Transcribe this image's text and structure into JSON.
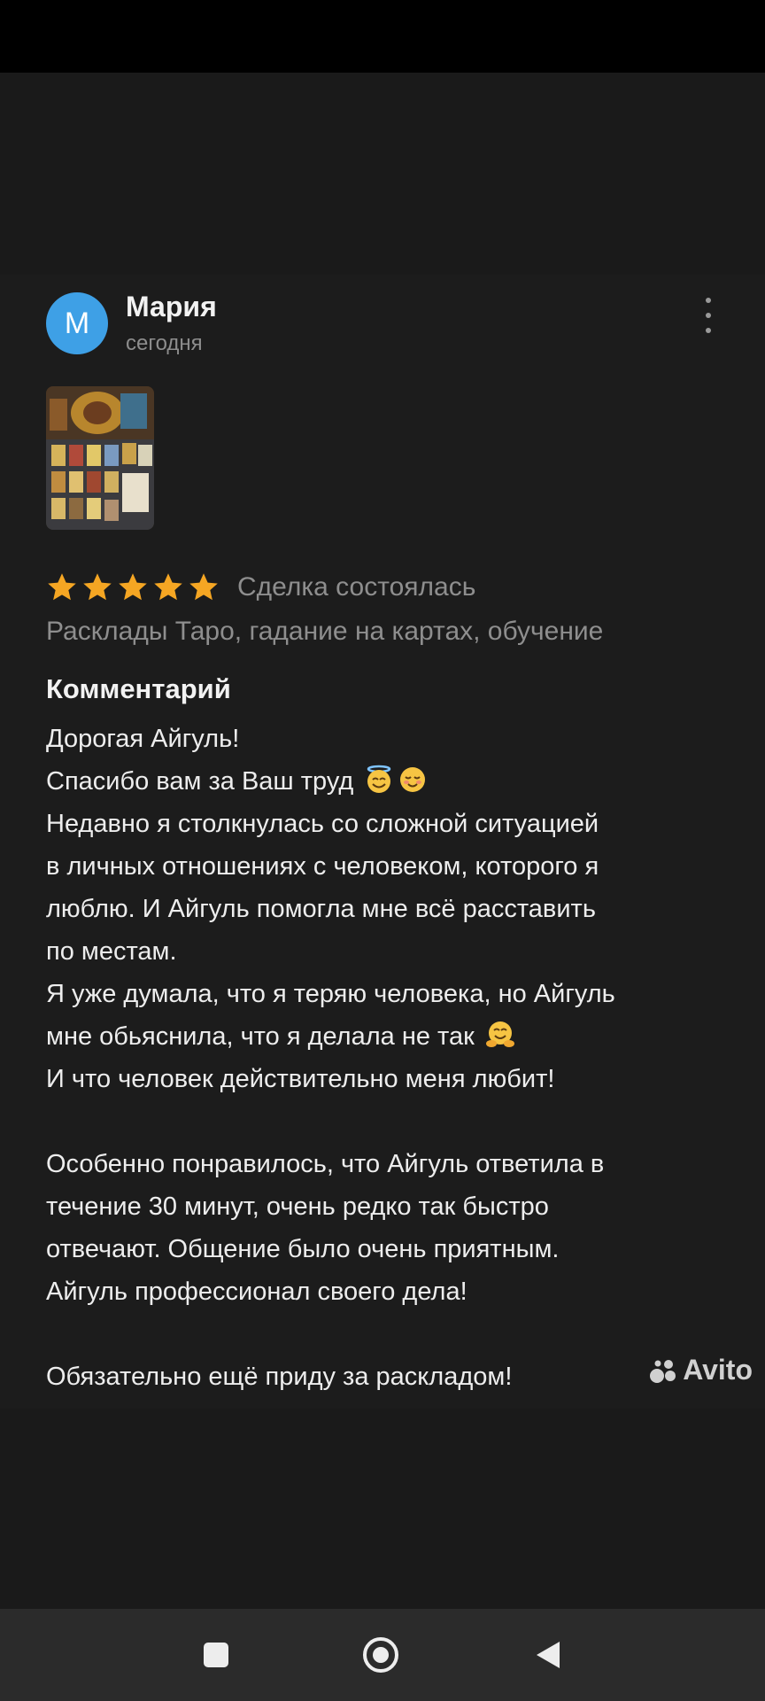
{
  "review": {
    "avatar_letter": "М",
    "author": "Мария",
    "date": "сегодня",
    "rating": 5,
    "deal_status": "Сделка состоялась",
    "category": "Расклады Таро, гадание на картах, обучение",
    "comment_title": "Комментарий",
    "comment_lines": [
      "Дорогая Айгуль!",
      "Спасибо вам за Ваш труд",
      "Недавно я столкнулась со сложной ситуацией",
      "в личных отношениях с человеком, которого я",
      "люблю. И Айгуль помогла мне всё расставить",
      "по местам.",
      "Я уже думала, что я теряю человека, но Айгуль",
      "мне обьяснила, что я делала не так",
      "И что человек действительно меня любит!",
      "",
      "Особенно понравилось, что Айгуль ответила в",
      "течение 30 минут, очень редко так быстро",
      "отвечают. Общение было очень приятным.",
      "Айгуль профессионал своего дела!",
      "",
      "Обязательно ещё приду за раскладом!"
    ]
  },
  "watermark": "Avito",
  "icons": {
    "more": "more-vertical-icon",
    "star": "star-icon",
    "nav_recent": "square-icon",
    "nav_home": "circle-icon",
    "nav_back": "triangle-back-icon"
  },
  "colors": {
    "background": "#1c1c1c",
    "avatar": "#3ea0e6",
    "star": "#f5a623",
    "text": "#ededed",
    "muted": "#8e8e8e"
  }
}
